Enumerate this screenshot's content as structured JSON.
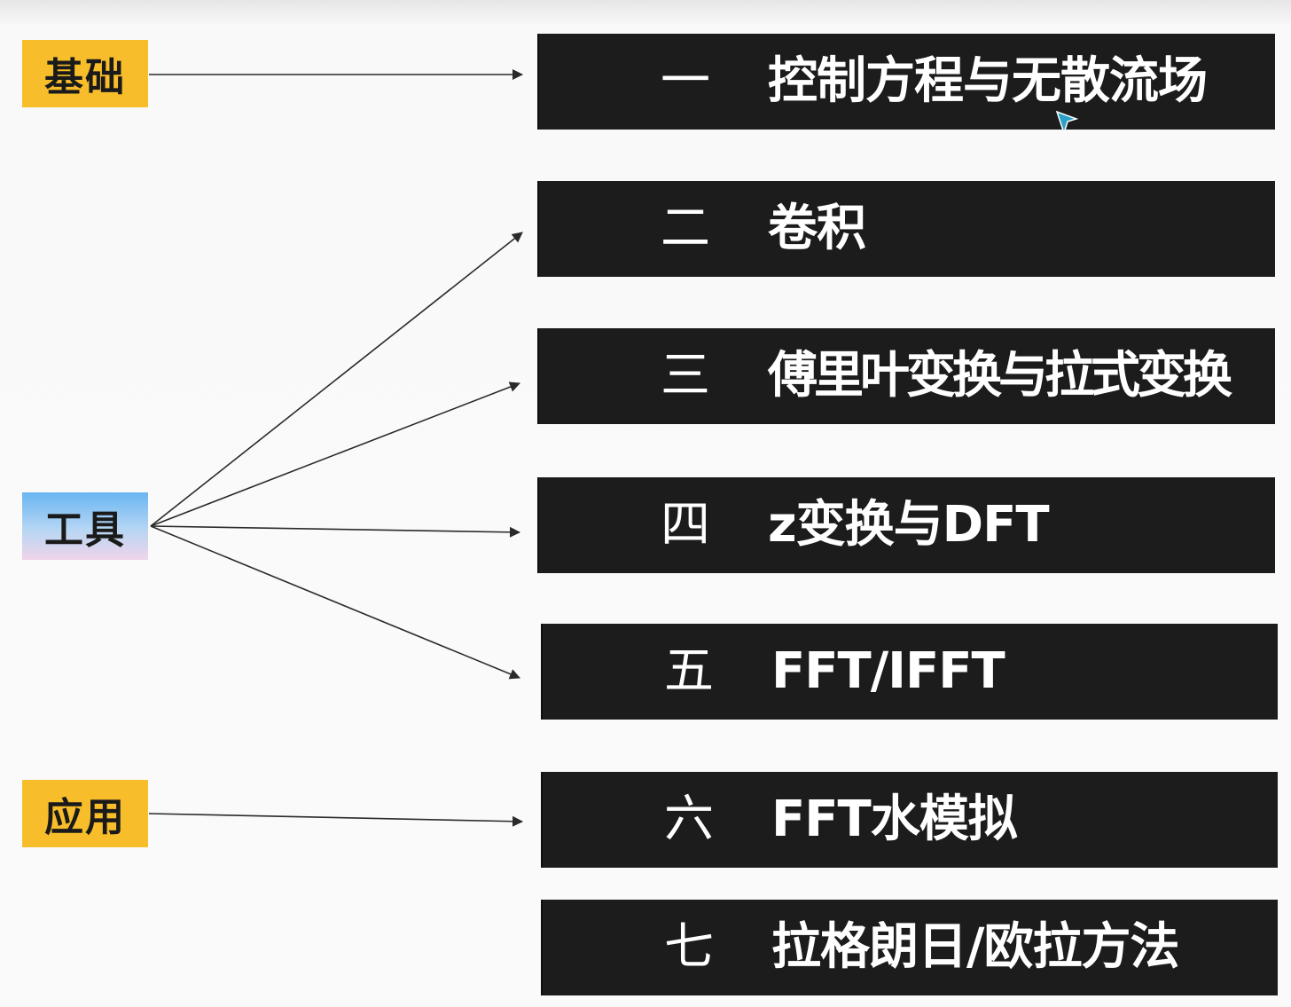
{
  "categories": {
    "basics": {
      "label": "基础",
      "color": "#f7bd2a"
    },
    "tools": {
      "label": "工具"
    },
    "applications": {
      "label": "应用",
      "color": "#f7bd2a"
    }
  },
  "chapters": [
    {
      "number": "一",
      "title": "控制方程与无散流场"
    },
    {
      "number": "二",
      "title": "卷积"
    },
    {
      "number": "三",
      "title": "傅里叶变换与拉式变换"
    },
    {
      "number": "四",
      "title": "z变换与DFT"
    },
    {
      "number": "五",
      "title": "FFT/IFFT"
    },
    {
      "number": "六",
      "title": "FFT水模拟"
    },
    {
      "number": "七",
      "title": "拉格朗日/欧拉方法"
    }
  ],
  "colors": {
    "box_background": "#1c1c1c",
    "box_text": "#ffffff",
    "arrow": "#2a2a2a",
    "cursor": "#2aa0c8"
  }
}
